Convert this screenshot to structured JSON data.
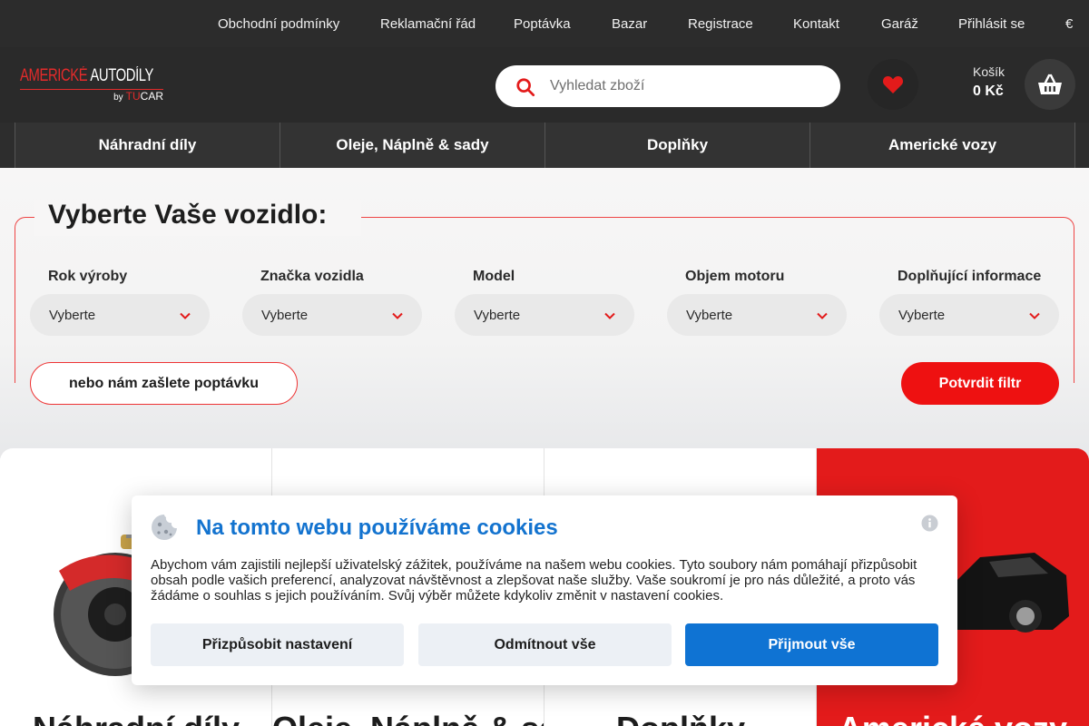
{
  "topbar": {
    "links": [
      "Obchodní podmínky",
      "Reklamační řád",
      "Poptávka",
      "Bazar",
      "Registrace",
      "Kontakt",
      "Garáž",
      "Přihlásit se",
      "€"
    ]
  },
  "logo": {
    "word1": "AMERICKÉ",
    "word2": "AUTODÍLY",
    "by": "by",
    "tu": "TU",
    "car": "CAR"
  },
  "search": {
    "placeholder": "Vyhledat zboží"
  },
  "cart": {
    "label": "Košík",
    "price": "0 Kč"
  },
  "catnav": [
    "Náhradní díly",
    "Oleje, Náplně & sady",
    "Doplňky",
    "Americké vozy"
  ],
  "vehicle_selector": {
    "title": "Vyberte Vaše vozidlo:",
    "fields": [
      {
        "label": "Rok výroby",
        "value": "Vyberte"
      },
      {
        "label": "Značka vozidla",
        "value": "Vyberte"
      },
      {
        "label": "Model",
        "value": "Vyberte"
      },
      {
        "label": "Objem motoru",
        "value": "Vyberte"
      },
      {
        "label": "Doplňující informace",
        "value": "Vyberte"
      }
    ],
    "inquiry_label": "nebo nám zašlete poptávku",
    "confirm_label": "Potvrdit filtr"
  },
  "cards": [
    "Náhradní díly",
    "Oleje, Náplně & sady",
    "Doplňky",
    "Americké vozy"
  ],
  "cookie": {
    "title": "Na tomto webu používáme cookies",
    "text": "Abychom vám zajistili nejlepší uživatelský zážitek, používáme na našem webu cookies. Tyto soubory nám pomáhají přizpůsobit obsah podle vašich preferencí, analyzovat návštěvnost a zlepšovat naše služby. Vaše soukromí je pro nás důležité, a proto vás žádáme o souhlas s jejich používáním. Svůj výběr můžete kdykoliv změnit v nastavení cookies.",
    "customize_label": "Přizpůsobit nastavení",
    "reject_label": "Odmítnout vše",
    "accept_label": "Přijmout vše"
  },
  "colors": {
    "brand_red": "#e31b1b",
    "accent_blue": "#0f73d3",
    "header_dark": "#2a2a2a"
  }
}
